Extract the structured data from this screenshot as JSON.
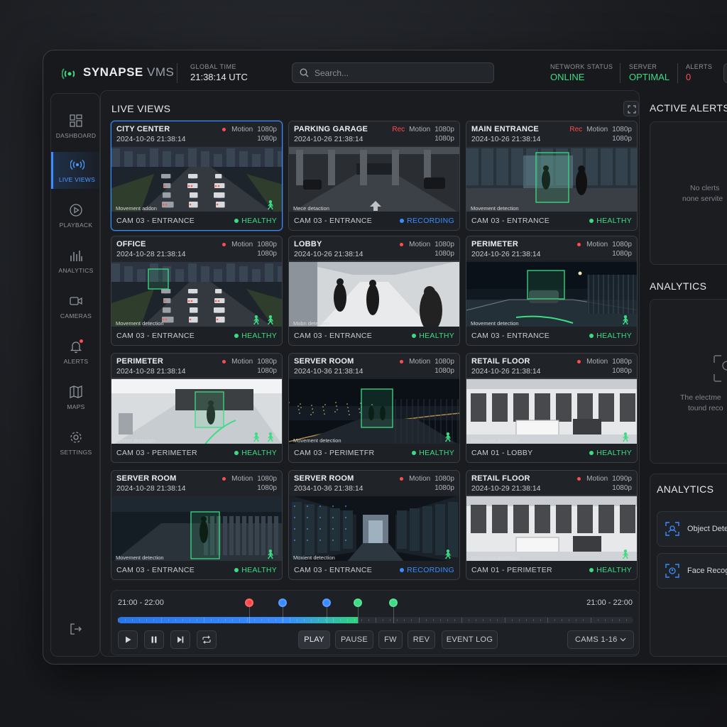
{
  "app": {
    "brand_main": "SYNAPSE",
    "brand_sub": "VMS"
  },
  "header": {
    "global_time_label": "GLOBAL TIME",
    "global_time_value": "21:38:14 UTC",
    "search_placeholder": "Search...",
    "network_label": "NETWORK STATUS",
    "network_value": "ONLINE",
    "server_label": "SERVER",
    "server_value": "OPTIMAL",
    "alerts_label": "ALERTS",
    "alerts_value": "0"
  },
  "sidebar": {
    "items": [
      {
        "label": "DASHBOARD",
        "icon": "dashboard-icon"
      },
      {
        "label": "LIVE VIEWS",
        "icon": "live-views-icon",
        "active": true
      },
      {
        "label": "PLAYBACK",
        "icon": "playback-icon"
      },
      {
        "label": "ANALYTICS",
        "icon": "analytics-icon"
      },
      {
        "label": "CAMERAS",
        "icon": "camera-icon"
      },
      {
        "label": "ALERTS",
        "icon": "bell-icon"
      },
      {
        "label": "MAPS",
        "icon": "map-icon"
      },
      {
        "label": "SETTINGS",
        "icon": "gear-icon"
      }
    ],
    "logout_icon": "logout-icon"
  },
  "main": {
    "title": "LIVE VIEWS",
    "cameras": [
      {
        "name": "CITY CENTER",
        "timestamp": "2024-10-26 21:38:14",
        "rec": "",
        "motion": "Motion",
        "res1": "1080p",
        "res2": "1080p",
        "caption": "Movement addon",
        "cam_id": "CAM 03 - ENTRANCE",
        "status": "HEALTHY"
      },
      {
        "name": "PARKING GARAGE",
        "timestamp": "2024-10-26 21:38:14",
        "rec": "Rec",
        "motion": "Motion",
        "res1": "1080p",
        "res2": "1080p",
        "caption": "Mece detaction",
        "cam_id": "CAM 03 - ENTRANCE",
        "status": "RECORDING"
      },
      {
        "name": "MAIN ENTRANCE",
        "timestamp": "2024-10-26 21:38:14",
        "rec": "Rec",
        "motion": "Motion",
        "res1": "1080p",
        "res2": "1080p",
        "caption": "Movement detection",
        "cam_id": "CAM 03 - ENTRANCE",
        "status": "HEALTHY"
      },
      {
        "name": "OFFICE",
        "timestamp": "2024-10-28 21:38:14",
        "rec": "",
        "motion": "Motion",
        "res1": "1080p",
        "res2": "1080p",
        "caption": "Movement detection",
        "cam_id": "CAM 03 - ENTRANCE",
        "status": "HEALTHY"
      },
      {
        "name": "LOBBY",
        "timestamp": "2024-10-26 21:38:14",
        "rec": "",
        "motion": "Motion",
        "res1": "1080p",
        "res2": "1080p",
        "caption": "Mobn detection",
        "cam_id": "CAM 03 - ENTRANCE",
        "status": "HEALTHY"
      },
      {
        "name": "PERIMETER",
        "timestamp": "2024-10-26 21:38:14",
        "rec": "",
        "motion": "Motion",
        "res1": "1080p",
        "res2": "1080p",
        "caption": "Movement detection",
        "cam_id": "CAM 03 - ENTRANCE",
        "status": "HEALTHY"
      },
      {
        "name": "PERIMETER",
        "timestamp": "2024-10-28 21:38:14",
        "rec": "",
        "motion": "Motion",
        "res1": "1080p",
        "res2": "1080p",
        "caption": "Motion decoclato",
        "cam_id": "CAM 03 - PERIMETER",
        "status": "HEALTHY"
      },
      {
        "name": "SERVER ROOM",
        "timestamp": "2024-10-36 21:38:14",
        "rec": "",
        "motion": "Motion",
        "res1": "1080p",
        "res2": "1080p",
        "caption": "Movement detection",
        "cam_id": "CAM 03 - PERIMETFR",
        "status": "HEALTHY"
      },
      {
        "name": "RETAIL FLOOR",
        "timestamp": "2024-10-26 21:38:14",
        "rec": "",
        "motion": "Motion",
        "res1": "1080p",
        "res2": "1080p",
        "caption": "Movement detection",
        "cam_id": "CAM 01 - LOBBY",
        "status": "HEALTHY"
      },
      {
        "name": "SERVER ROOM",
        "timestamp": "2024-10-28 21:38:14",
        "rec": "",
        "motion": "Motion",
        "res1": "1080p",
        "res2": "1080p",
        "caption": "Movement detection",
        "cam_id": "CAM 03 - ENTRANCE",
        "status": "HEALTHY"
      },
      {
        "name": "SERVER ROOM",
        "timestamp": "2034-10-36 21:38:14",
        "rec": "",
        "motion": "Motion",
        "res1": "1080p",
        "res2": "1080p",
        "caption": "Moxient detection",
        "cam_id": "CAM 03 - ENTRANCE",
        "status": "RECORDING"
      },
      {
        "name": "RETAIL FLOOR",
        "timestamp": "2024-10-29 21:38:14",
        "rec": "",
        "motion": "Motion",
        "res1": "1090p",
        "res2": "1080p",
        "caption": "Movement detection",
        "cam_id": "CAM 01 - PERIMETER",
        "status": "HEALTHY"
      }
    ]
  },
  "timeline": {
    "start_label": "21:00 - 22:00",
    "end_label": "21:00 - 22:00",
    "progress": 0.465,
    "markers": [
      {
        "pos": 0.255,
        "color": "#ff4d4d"
      },
      {
        "pos": 0.32,
        "color": "#3b8cff"
      },
      {
        "pos": 0.405,
        "color": "#3b8cff"
      },
      {
        "pos": 0.465,
        "color": "#3ddc84"
      },
      {
        "pos": 0.535,
        "color": "#3ddc84"
      }
    ],
    "buttons": {
      "play": "PLAY",
      "pause": "PAUSE",
      "fw": "FW",
      "rev": "REV",
      "event_log": "EVENT LOG"
    },
    "cams_select": "CAMS 1-16"
  },
  "right": {
    "alerts_title": "ACTIVE ALERTS",
    "alerts_empty_line1": "No clerts",
    "alerts_empty_line2": "none servite",
    "analytics_title_1": "ANALYTICS",
    "analytics_text_line1": "The electme",
    "analytics_text_line2": "tound reco",
    "analytics_title_2": "ANALYTICS",
    "items": [
      {
        "label": "Object Dete"
      },
      {
        "label": "Face Recog"
      }
    ]
  },
  "colors": {
    "accent": "#3b8cff",
    "healthy": "#3ddc84",
    "alert": "#ff4d4d"
  }
}
